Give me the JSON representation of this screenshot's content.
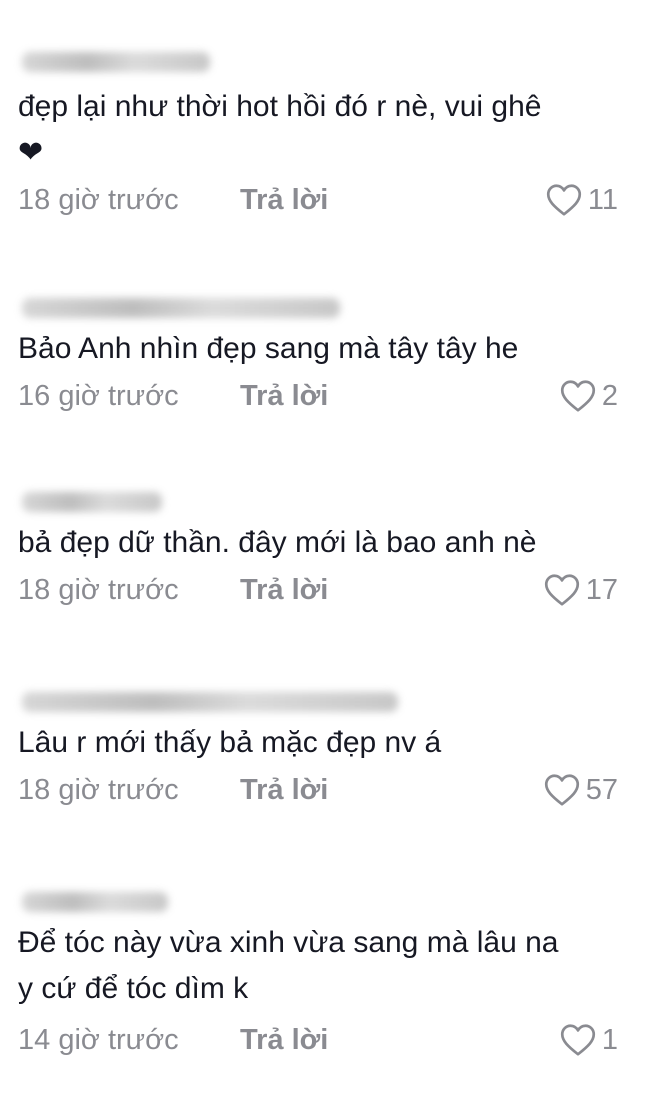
{
  "comments": [
    {
      "text": "đẹp lại như thời hot hồi đó r nè, vui ghê\n❤",
      "time": "18 giờ trước",
      "reply_label": "Trả lời",
      "likes": "11"
    },
    {
      "text": "Bảo Anh nhìn đẹp sang mà tây tây he",
      "time": "16 giờ trước",
      "reply_label": "Trả lời",
      "likes": "2"
    },
    {
      "text": "bả đẹp dữ thần. đây mới là bao anh nè",
      "time": "18 giờ trước",
      "reply_label": "Trả lời",
      "likes": "17"
    },
    {
      "text": "Lâu r mới thấy bả mặc đẹp nv á",
      "time": "18 giờ trước",
      "reply_label": "Trả lời",
      "likes": "57"
    },
    {
      "text": "Để tóc này vừa xinh vừa sang mà lâu na\ny cứ để tóc dìm k",
      "time": "14 giờ trước",
      "reply_label": "Trả lời",
      "likes": "1"
    }
  ],
  "icons": {
    "like": "heart-outline-icon"
  },
  "colors": {
    "text": "#161823",
    "meta": "#8a8b91"
  }
}
